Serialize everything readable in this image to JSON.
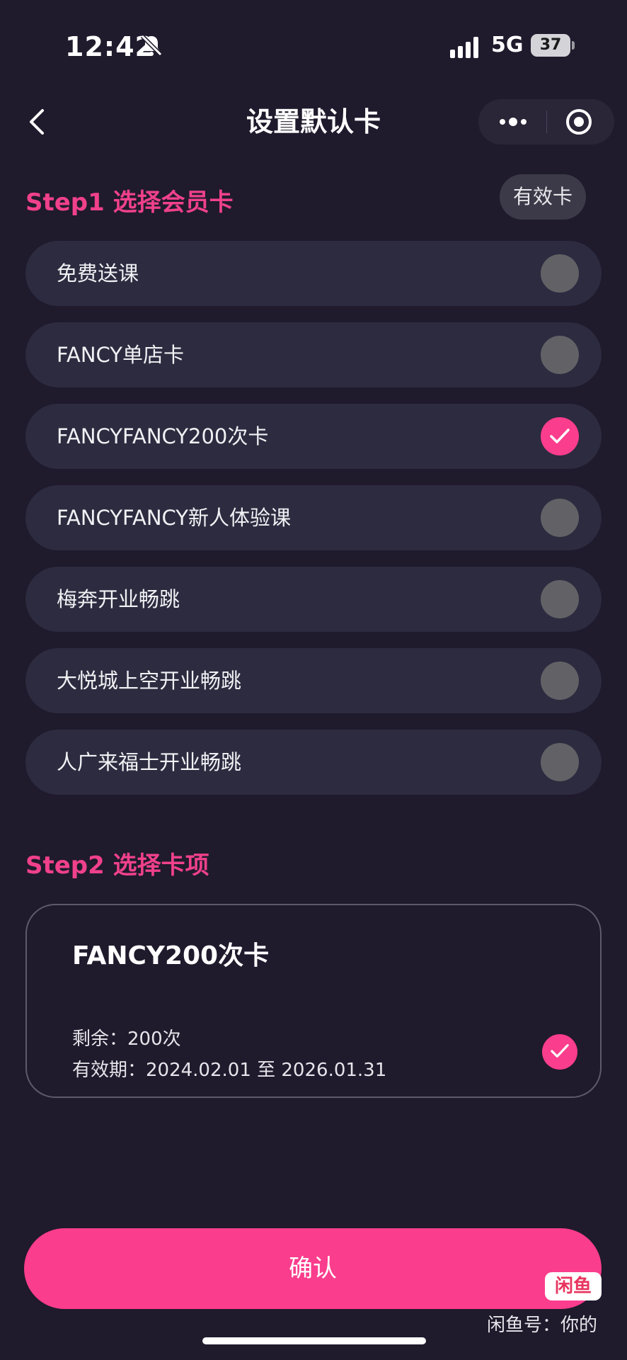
{
  "status_bar": {
    "time": "12:42",
    "network": "5G",
    "battery": "37"
  },
  "nav": {
    "title": "设置默认卡"
  },
  "step1": {
    "title": "Step1 选择会员卡",
    "filter_button": "有效卡",
    "cards": [
      {
        "label": "免费送课",
        "selected": false
      },
      {
        "label": "FANCY单店卡",
        "selected": false
      },
      {
        "label": "FANCYFANCY200次卡",
        "selected": true
      },
      {
        "label": "FANCYFANCY新人体验课",
        "selected": false
      },
      {
        "label": "梅奔开业畅跳",
        "selected": false
      },
      {
        "label": "大悦城上空开业畅跳",
        "selected": false
      },
      {
        "label": "人广来福士开业畅跳",
        "selected": false
      }
    ]
  },
  "step2": {
    "title": "Step2 选择卡项",
    "card": {
      "name": "FANCY200次卡",
      "remaining": "剩余：200次",
      "validity": "有效期：2024.02.01 至 2026.01.31",
      "selected": true
    }
  },
  "confirm_label": "确认",
  "watermark": {
    "logo": "闲鱼",
    "text": "闲鱼号：你的"
  },
  "colors": {
    "accent": "#fa3d8c",
    "background": "#1f1a2c",
    "card_bg": "#2d2b40",
    "radio_off": "#626266"
  }
}
